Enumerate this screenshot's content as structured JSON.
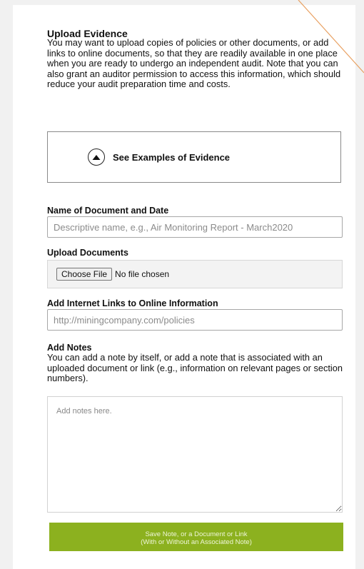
{
  "upload": {
    "heading": "Upload Evidence",
    "intro": "You may want to upload copies of policies or other documents, or add links to online documents, so that they are readily available in one place when you are ready to undergo an independent audit. Note that you can also grant an auditor permission to access this information, which should reduce your audit preparation time and costs."
  },
  "examples": {
    "label": "See Examples of Evidence",
    "icon": "chevron-up-icon"
  },
  "document_name": {
    "label": "Name of Document and Date",
    "placeholder": "Descriptive name, e.g., Air Monitoring Report - March2020"
  },
  "upload_documents": {
    "label": "Upload Documents",
    "button_label": "Choose File",
    "status": "No file chosen"
  },
  "links": {
    "label": "Add Internet Links to Online Information",
    "placeholder": "http://miningcompany.com/policies"
  },
  "notes": {
    "label": "Add Notes",
    "description": "You can add a note by itself, or add a note that is associated with an uploaded document or link (e.g., information on relevant pages or section numbers).",
    "placeholder": "Add notes here."
  },
  "save": {
    "line1": "Save Note, or a Document or Link",
    "line2": "(With or Without an Associated Note)"
  },
  "colors": {
    "accent_green": "#8cb11f",
    "decor_line": "#e8a061"
  }
}
